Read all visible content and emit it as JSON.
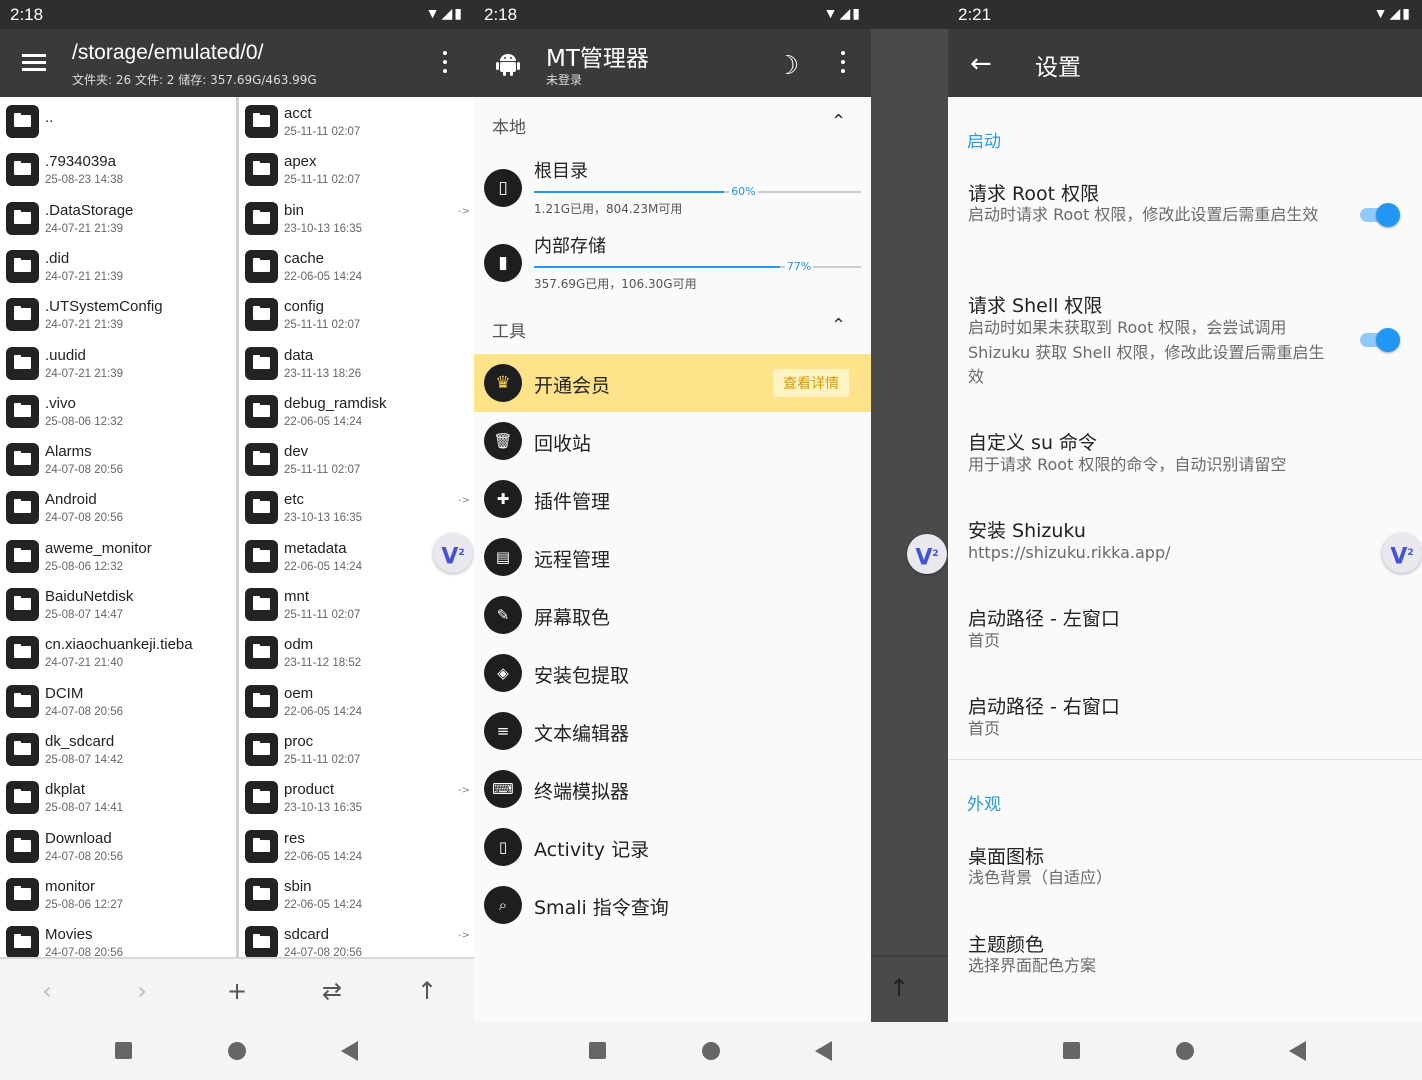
{
  "panel1": {
    "status_time": "2:18",
    "path": "/storage/emulated/0/",
    "summary": "文件夹: 26  文件: 2  储存: 357.69G/463.99G",
    "left_files": [
      {
        "name": "..",
        "date": ""
      },
      {
        "name": ".7934039a",
        "date": "25-08-23 14:38"
      },
      {
        "name": ".DataStorage",
        "date": "24-07-21 21:39"
      },
      {
        "name": ".did",
        "date": "24-07-21 21:39"
      },
      {
        "name": ".UTSystemConfig",
        "date": "24-07-21 21:39"
      },
      {
        "name": ".uudid",
        "date": "24-07-21 21:39"
      },
      {
        "name": ".vivo",
        "date": "25-08-06 12:32"
      },
      {
        "name": "Alarms",
        "date": "24-07-08 20:56"
      },
      {
        "name": "Android",
        "date": "24-07-08 20:56"
      },
      {
        "name": "aweme_monitor",
        "date": "25-08-06 12:32"
      },
      {
        "name": "BaiduNetdisk",
        "date": "25-08-07 14:47"
      },
      {
        "name": "cn.xiaochuankeji.tieba",
        "date": "24-07-21 21:40"
      },
      {
        "name": "DCIM",
        "date": "24-07-08 20:56"
      },
      {
        "name": "dk_sdcard",
        "date": "25-08-07 14:42"
      },
      {
        "name": "dkplat",
        "date": "25-08-07 14:41"
      },
      {
        "name": "Download",
        "date": "24-07-08 20:56"
      },
      {
        "name": "monitor",
        "date": "25-08-06 12:27"
      },
      {
        "name": "Movies",
        "date": "24-07-08 20:56"
      }
    ],
    "right_files": [
      {
        "name": "acct",
        "date": "25-11-11 02:07",
        "link": false
      },
      {
        "name": "apex",
        "date": "25-11-11 02:07",
        "link": false
      },
      {
        "name": "bin",
        "date": "23-10-13 16:35",
        "link": true
      },
      {
        "name": "cache",
        "date": "22-06-05 14:24",
        "link": false
      },
      {
        "name": "config",
        "date": "25-11-11 02:07",
        "link": false
      },
      {
        "name": "data",
        "date": "23-11-13 18:26",
        "link": false
      },
      {
        "name": "debug_ramdisk",
        "date": "22-06-05 14:24",
        "link": false
      },
      {
        "name": "dev",
        "date": "25-11-11 02:07",
        "link": false
      },
      {
        "name": "etc",
        "date": "23-10-13 16:35",
        "link": true
      },
      {
        "name": "metadata",
        "date": "22-06-05 14:24",
        "link": false
      },
      {
        "name": "mnt",
        "date": "25-11-11 02:07",
        "link": false
      },
      {
        "name": "odm",
        "date": "23-11-12 18:52",
        "link": false
      },
      {
        "name": "oem",
        "date": "22-06-05 14:24",
        "link": false
      },
      {
        "name": "proc",
        "date": "25-11-11 02:07",
        "link": false
      },
      {
        "name": "product",
        "date": "23-10-13 16:35",
        "link": true
      },
      {
        "name": "res",
        "date": "22-06-05 14:24",
        "link": false
      },
      {
        "name": "sbin",
        "date": "22-06-05 14:24",
        "link": false
      },
      {
        "name": "sdcard",
        "date": "24-07-08 20:56",
        "link": true
      }
    ],
    "link_mark": "->",
    "badge": "V",
    "badge_count": "2",
    "bottom_icons": [
      "chevron-left-icon",
      "chevron-right-icon",
      "plus-icon",
      "swap-icon",
      "arrow-up-icon"
    ]
  },
  "panel2": {
    "status_time": "2:18",
    "app_title": "MT管理器",
    "login_status": "未登录",
    "local_header": "本地",
    "storage": [
      {
        "name": "根目录",
        "percent": 60,
        "percent_label": "60%",
        "info": "1.21G已用，804.23M可用",
        "icon": "phone-icon"
      },
      {
        "name": "内部存储",
        "percent": 77,
        "percent_label": "77%",
        "info": "357.69G已用，106.30G可用",
        "icon": "sdcard-icon"
      }
    ],
    "tools_header": "工具",
    "vip": {
      "label": "开通会员",
      "button": "查看详情"
    },
    "tools": [
      {
        "label": "回收站",
        "icon": "trash-icon"
      },
      {
        "label": "插件管理",
        "icon": "puzzle-icon"
      },
      {
        "label": "远程管理",
        "icon": "file-icon"
      },
      {
        "label": "屏幕取色",
        "icon": "eyedropper-icon"
      },
      {
        "label": "安装包提取",
        "icon": "layers-icon"
      },
      {
        "label": "文本编辑器",
        "icon": "document-icon"
      },
      {
        "label": "终端模拟器",
        "icon": "terminal-icon"
      },
      {
        "label": "Activity 记录",
        "icon": "phone-icon"
      },
      {
        "label": "Smali 指令查询",
        "icon": "search-icon"
      }
    ],
    "colors": {
      "accent": "#2196f3",
      "vip_bg": "#ffe38a",
      "vip_text": "#d89b00"
    }
  },
  "panel3": {
    "status_time": "2:21",
    "title": "设置",
    "startup_header": "启动",
    "items": [
      {
        "title": "请求 Root 权限",
        "desc": "启动时请求 Root 权限，修改此设置后需重启生效",
        "toggle": true
      },
      {
        "title": "请求 Shell 权限",
        "desc": "启动时如果未获取到 Root 权限，会尝试调用 Shizuku 获取 Shell 权限，修改此设置后需重启生效",
        "toggle": true
      },
      {
        "title": "自定义 su 命令",
        "desc": "用于请求 Root 权限的命令，自动识别请留空"
      },
      {
        "title": "安装 Shizuku",
        "desc": "https://shizuku.rikka.app/"
      },
      {
        "title": "启动路径 - 左窗口",
        "desc": "首页"
      },
      {
        "title": "启动路径 - 右窗口",
        "desc": "首页"
      }
    ],
    "appearance_header": "外观",
    "appearance_items": [
      {
        "title": "桌面图标",
        "desc": "浅色背景（自适应）"
      },
      {
        "title": "主题颜色",
        "desc": "选择界面配色方案"
      }
    ]
  }
}
